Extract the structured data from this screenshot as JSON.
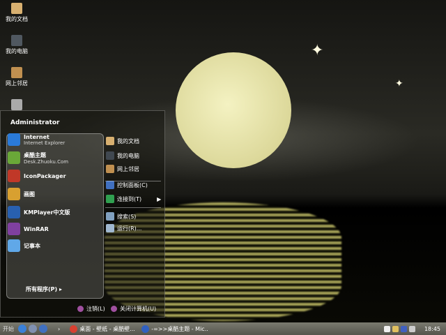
{
  "desktop": {
    "icons": [
      {
        "label": "我的文档",
        "icon": "folder-icon"
      },
      {
        "label": "我的电脑",
        "icon": "computer-icon"
      },
      {
        "label": "网上邻居",
        "icon": "network-icon"
      },
      {
        "label": "",
        "icon": "recycle-bin-icon"
      }
    ]
  },
  "start_menu": {
    "user": "Administrator",
    "pinned": [
      {
        "title": "Internet",
        "subtitle": "Internet Explorer",
        "color": "#2a7ad8"
      },
      {
        "title": "桌酷主题",
        "subtitle": "Desk.Zhuoku.Com",
        "color": "#6aa838"
      },
      {
        "title": "IconPackager",
        "subtitle": "",
        "color": "#c03828"
      },
      {
        "title": "画图",
        "subtitle": "",
        "color": "#d8a030"
      },
      {
        "title": "KMPlayer中文版",
        "subtitle": "",
        "color": "#2860b0"
      },
      {
        "title": "WinRAR",
        "subtitle": "",
        "color": "#8040a0"
      },
      {
        "title": "记事本",
        "subtitle": "",
        "color": "#60a8e8"
      }
    ],
    "all_programs": "所有程序(P)",
    "right": [
      {
        "label": "我的文档",
        "color": "#d8b070"
      },
      {
        "label": "我的电脑",
        "color": "#404850"
      },
      {
        "label": "网上邻居",
        "color": "#c09050"
      },
      {
        "label": "控制面板(C)",
        "color": "#4070c0"
      },
      {
        "label": "连接到(T)",
        "color": "#30a050",
        "arrow": "▶"
      },
      {
        "label": "搜索(S)",
        "color": "#80a0c0"
      },
      {
        "label": "运行(R)...",
        "color": "#a0b8d0"
      }
    ],
    "logoff": "注销(L)",
    "shutdown": "关闭计算机(U)"
  },
  "taskbar": {
    "start_label": "开始",
    "quicklaunch": [
      "ie-icon",
      "media-icon",
      "desktop-icon"
    ],
    "expand": "›",
    "tasks": [
      {
        "label": "桌面 - 壁纸 - 桌酷壁...",
        "icon": "chrome-icon"
      },
      {
        "label": "-=>>桌酷主题 - Mic...",
        "icon": "word-icon"
      }
    ],
    "clock": "18:45"
  }
}
